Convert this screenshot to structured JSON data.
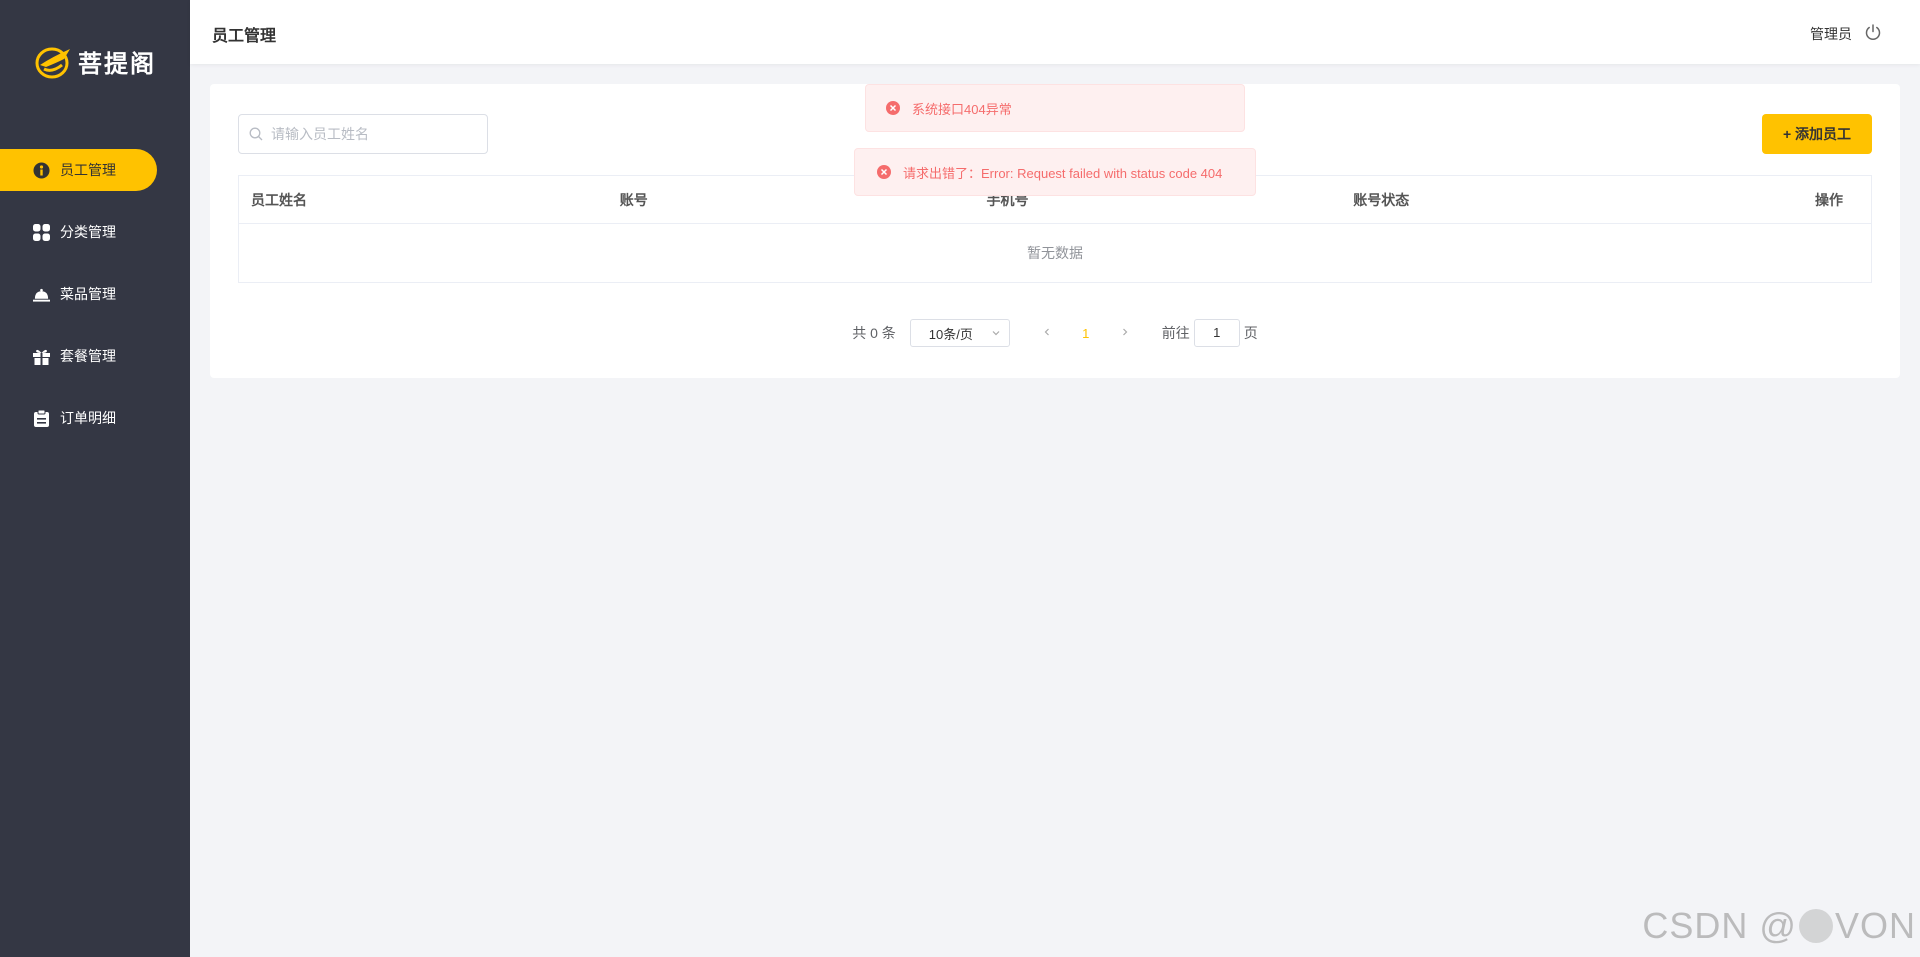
{
  "brand": {
    "name": "菩提阁",
    "accent": "#ffc200",
    "sidebar_bg": "#343744"
  },
  "sidebar": {
    "items": [
      {
        "label": "员工管理",
        "icon": "employee-icon",
        "active": true
      },
      {
        "label": "分类管理",
        "icon": "category-grid-icon",
        "active": false
      },
      {
        "label": "菜品管理",
        "icon": "dish-cloche-icon",
        "active": false
      },
      {
        "label": "套餐管理",
        "icon": "gift-icon",
        "active": false
      },
      {
        "label": "订单明细",
        "icon": "clipboard-icon",
        "active": false
      }
    ]
  },
  "header": {
    "title": "员工管理",
    "user": "管理员",
    "logout_icon": "power-icon"
  },
  "toolbar": {
    "search_placeholder": "请输入员工姓名",
    "add_label": "+ 添加员工"
  },
  "table": {
    "columns": [
      "员工姓名",
      "账号",
      "手机号",
      "账号状态",
      "操作"
    ],
    "rows": [],
    "empty_text": "暂无数据"
  },
  "pagination": {
    "total_text": "共 0 条",
    "page_size": "10条/页",
    "current_page": "1",
    "goto_prefix": "前往",
    "goto_value": "1",
    "goto_suffix": "页"
  },
  "toasts": [
    {
      "message": "系统接口404异常",
      "type": "error"
    },
    {
      "message": "请求出错了：Error: Request failed with status code 404",
      "type": "error"
    }
  ],
  "watermark": {
    "prefix": "CSDN @",
    "suffix": "VON"
  }
}
